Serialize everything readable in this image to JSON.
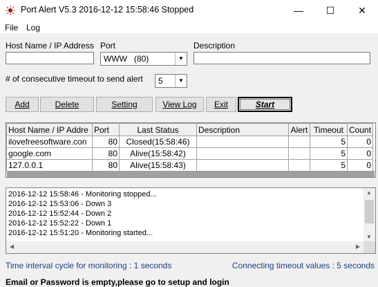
{
  "window": {
    "title": "Port Alert V5.3 2016-12-12 15:58:46 Stopped",
    "controls": {
      "minimize": "—",
      "maximize": "☐",
      "close": "✕"
    }
  },
  "menu": [
    "File",
    "Log"
  ],
  "form": {
    "host_label": "Host Name / IP Address",
    "host_value": "",
    "port_label": "Port",
    "port_value": "WWW   (80)",
    "description_label": "Description",
    "description_value": "",
    "timeout_label": "# of consecutive timeout to send alert",
    "timeout_value": "5"
  },
  "buttons": {
    "add": "Add",
    "delete": "Delete",
    "setting": "Setting",
    "view_log": "View Log",
    "exit": "Exit",
    "start": "Start"
  },
  "grid": {
    "columns": [
      "Host Name / IP Addre",
      "Port",
      "Last Status",
      "Description",
      "Alert",
      "Timeout",
      "Count"
    ],
    "rows": [
      [
        "ilovefreesoftware.con",
        "80",
        "Closed(15:58:46)",
        "",
        "",
        "5",
        "0"
      ],
      [
        "google.com",
        "80",
        "Alive(15:58:42)",
        "",
        "",
        "5",
        "0"
      ],
      [
        "127.0.0.1",
        "80",
        "Alive(15:58:43)",
        "",
        "",
        "5",
        "0"
      ]
    ]
  },
  "log": [
    "2016-12-12 15:58:46 - Monitoring stopped...",
    "2016-12-12 15:53:06 -  Down 3",
    "2016-12-12 15:52:44 -  Down 2",
    "2016-12-12 15:52:22 -  Down 1",
    "2016-12-12 15:51:20 - Monitoring started..."
  ],
  "info": {
    "interval": "Time interval cycle for monitoring : 1 seconds",
    "timeout": "Connecting timeout values : 5 seconds"
  },
  "status": "Email or Password is empty,please go to setup and login",
  "colors": {
    "info_text": "#1a3c8c",
    "icon_red": "#c0392b"
  }
}
